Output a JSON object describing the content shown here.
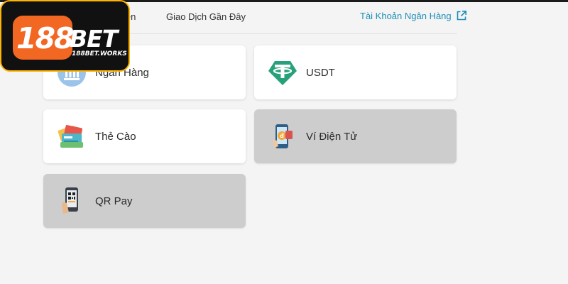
{
  "header": {
    "tabs": [
      {
        "label": "iền"
      },
      {
        "label": "Giao Dịch Gần Đây"
      }
    ],
    "bank_account_link": "Tài Khoản Ngân Hàng",
    "bank_account_icon": "external-link-icon"
  },
  "methods": [
    {
      "label": "Ngân Hàng",
      "icon": "bank-icon",
      "enabled": true
    },
    {
      "label": "USDT",
      "icon": "tether-icon",
      "enabled": true
    },
    {
      "label": "Thẻ Cào",
      "icon": "scratch-card-icon",
      "enabled": true
    },
    {
      "label": "Ví Điện Tử",
      "icon": "e-wallet-icon",
      "enabled": false
    },
    {
      "label": "QR Pay",
      "icon": "qr-pay-icon",
      "enabled": false
    }
  ],
  "logo": {
    "number": "188",
    "word": "BET",
    "domain": "188BET.WORKS"
  },
  "colors": {
    "accent": "#1c8fb8",
    "logo_orange": "#f26722",
    "logo_border": "#ffb400",
    "disabled_card": "#cdcdcd",
    "usdt_green": "#26a17b"
  }
}
